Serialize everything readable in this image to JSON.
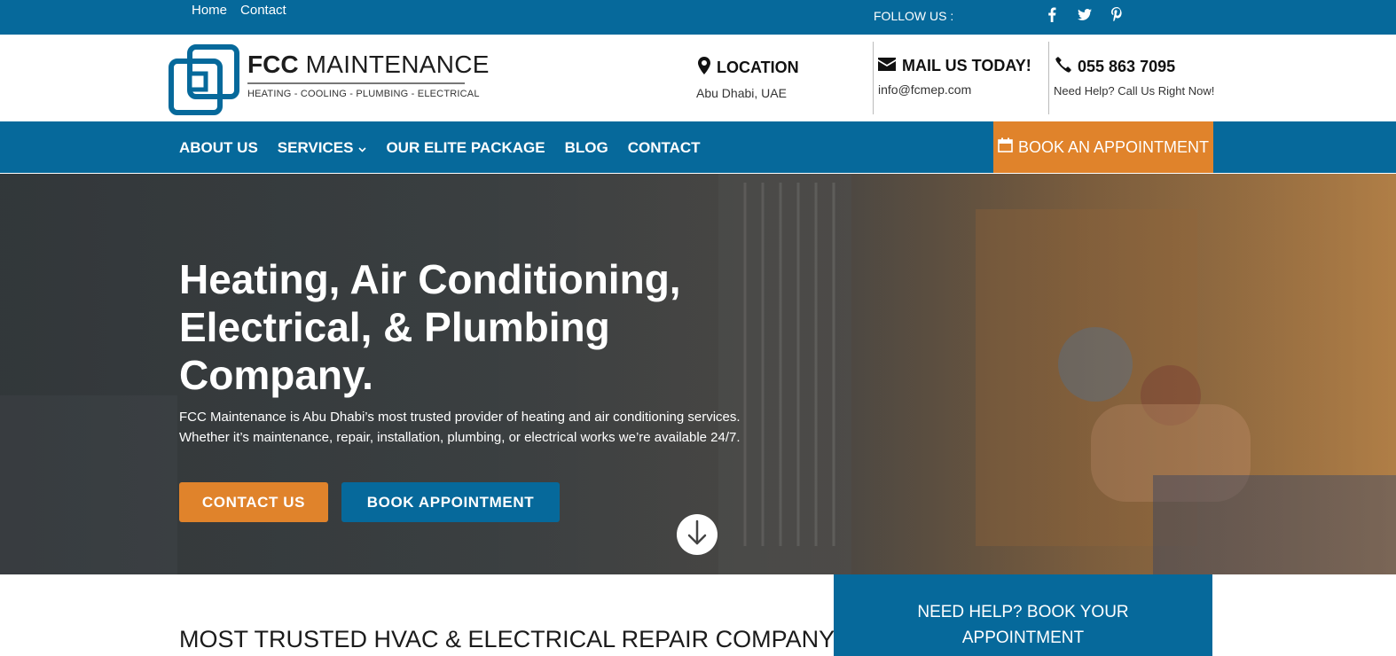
{
  "colors": {
    "brand_blue": "#06699b",
    "accent_orange": "#e0832b"
  },
  "topbar": {
    "links": [
      "Home",
      "Contact"
    ],
    "follow_label": "FOLLOW US :",
    "social_icons": [
      "facebook-icon",
      "twitter-icon",
      "pinterest-icon"
    ]
  },
  "logo": {
    "brand_bold": "FCC",
    "brand_rest": "MAINTENANCE",
    "tagline": "HEATING - COOLING - PLUMBING - ELECTRICAL"
  },
  "header": {
    "location": {
      "title": "LOCATION",
      "detail": "Abu Dhabi, UAE",
      "icon": "map-pin-icon"
    },
    "mail": {
      "title": "MAIL US TODAY!",
      "detail": "info@fcmep.com",
      "icon": "envelope-icon"
    },
    "phone": {
      "title": "055 863 7095",
      "detail": "Need Help? Call Us Right Now!",
      "icon": "phone-icon"
    }
  },
  "nav": {
    "items": [
      "ABOUT US",
      "SERVICES",
      "OUR ELITE PACKAGE",
      "BLOG",
      "CONTACT"
    ],
    "book_label": "BOOK AN APPOINTMENT"
  },
  "hero": {
    "title": "Heating, Air Conditioning, Electrical, & Plumbing Company.",
    "description_line1": "FCC Maintenance is Abu Dhabi’s most trusted provider of heating and air conditioning services.",
    "description_line2": "Whether it’s maintenance, repair, installation, plumbing, or electrical works we’re available 24/7.",
    "contact_button": "CONTACT US",
    "book_button": "BOOK APPOINTMENT"
  },
  "section": {
    "heading": "MOST TRUSTED HVAC & ELECTRICAL REPAIR COMPANY",
    "help_box_line1": "NEED HELP? BOOK YOUR",
    "help_box_line2": "APPOINTMENT"
  }
}
